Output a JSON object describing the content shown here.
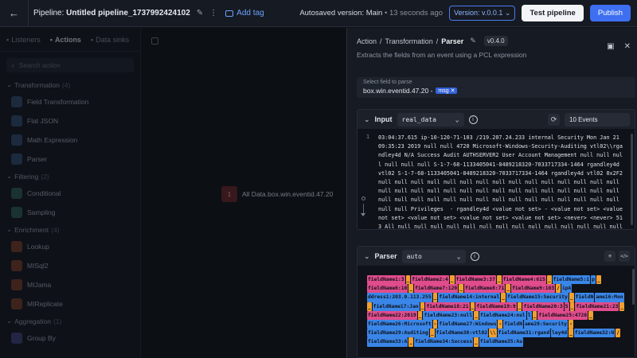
{
  "topbar": {
    "back_icon": "arrow-left-icon",
    "title_prefix": "Pipeline:",
    "title_name": "Untitled pipeline_1737992424102",
    "add_tag_label": "Add tag",
    "autosave_label": "Autosaved version: Main",
    "autosave_time": "• 13 seconds ago",
    "version_label": "Version: v.0.0.1 ⌄",
    "test_label": "Test pipeline",
    "publish_label": "Publish"
  },
  "left": {
    "tabs": [
      {
        "label": "Listeners",
        "icon": "headset-icon"
      },
      {
        "label": "Actions",
        "icon": "actions-icon"
      },
      {
        "label": "Data sinks",
        "icon": "database-icon"
      }
    ],
    "search_placeholder": "Search action",
    "sections": [
      {
        "title": "Transformation",
        "count": "(4)",
        "items": [
          {
            "label": "Field Transformation",
            "color": "#2f4a6e"
          },
          {
            "label": "Flat JSON",
            "color": "#2f4a6e"
          },
          {
            "label": "Math Expression",
            "color": "#2f4a6e"
          },
          {
            "label": "Parser",
            "color": "#2f4a6e"
          }
        ]
      },
      {
        "title": "Filtering",
        "count": "(2)",
        "items": [
          {
            "label": "Conditional",
            "color": "#2a5a52"
          },
          {
            "label": "Sampling",
            "color": "#2a5a52"
          }
        ]
      },
      {
        "title": "Enrichment",
        "count": "(4)",
        "items": [
          {
            "label": "Lookup",
            "color": "#7a3a24"
          },
          {
            "label": "MISql2",
            "color": "#7a3a24"
          },
          {
            "label": "MIJama",
            "color": "#7a3a24"
          },
          {
            "label": "MIReplicate",
            "color": "#7a3a24"
          }
        ]
      },
      {
        "title": "Aggregation",
        "count": "(1)",
        "items": [
          {
            "label": "Group By",
            "color": "#3b3f7a"
          }
        ]
      }
    ]
  },
  "canvas": {
    "node_badge": "1",
    "node_label": "All Data.box.win.eventid.47.20"
  },
  "right": {
    "breadcrumb": [
      "Action",
      "Transformation",
      "Parser"
    ],
    "version_badge": "v0.4.0",
    "subtitle": "Extracts the fields from an event using a PCL expression",
    "field_label": "Select field to parse",
    "field_value": "box.win.eventid.47.20 -",
    "field_tag": "msg ✕",
    "input": {
      "label": "Input",
      "source": "real_data",
      "events": "10 Events",
      "line_number": "1",
      "code": "03:04:37.615 ip-10-120-71-103 /219.207.24.233 internal Security Mon Jan 21 09:35:23 2019 null null 4720 Microsoft-Windows-Security-Auditing vtl02\\\\rgandley4d N/A Success Audit AUTHSERVER2 User Account Management null null null null null null S-1-7-68-1133405041-8489218320-7033717334-1464 rgandley4d vtl02 S-1-7-68-1133405041-8489218320-7033717334-1464 rgandley4d vtl02 0x2F2 null null null null null null null null null null null null null null null null null null null null null null null null null null null null null null null null null null null null null null null null null null null null null null null Privileges  - rgandley4d <value not set> - <value not set> <value not set> <value not set> <value not set> <value not set> <never> <never> 513 All null null null null null null null null null null null null null null null null null null null null null null null null null null null null null null null"
    },
    "parser": {
      "label": "Parser",
      "mode": "auto",
      "tools": [
        "≡",
        "</>"
      ],
      "tokens": [
        {
          "t": "fieldName1:3",
          "c": "pk"
        },
        {
          "t": "_",
          "c": "or"
        },
        {
          "t": "fieldName2:4",
          "c": "pk"
        },
        {
          "t": "_",
          "c": "or"
        },
        {
          "t": "fieldName3:37",
          "c": "pk"
        },
        {
          "t": "_",
          "c": "or"
        },
        {
          "t": "fieldName4:615",
          "c": "pk"
        },
        {
          "t": "_",
          "c": "or"
        },
        {
          "t": "fieldName5:i",
          "c": "bl"
        },
        {
          "t": "p",
          "c": "bl"
        },
        {
          "t": "_",
          "c": "or"
        },
        {
          "t": "fieldName6:10",
          "c": "pk"
        },
        {
          "t": "_",
          "c": "or"
        },
        {
          "t": "fieldName7:120",
          "c": "pk"
        },
        {
          "t": "_",
          "c": "or"
        },
        {
          "t": "fieldName8:71",
          "c": "pk"
        },
        {
          "t": "_",
          "c": "or"
        },
        {
          "t": "fieldName9:103",
          "c": "pk"
        },
        {
          "t": "/",
          "c": "or"
        },
        {
          "t": "ipA",
          "c": "bl"
        },
        {
          "t": "ddress1:203.0.113.255",
          "c": "bl"
        },
        {
          "t": "_",
          "c": "or"
        },
        {
          "t": "fieldName14:internal",
          "c": "bl"
        },
        {
          "t": "_",
          "c": "or"
        },
        {
          "t": "fieldName15:Security",
          "c": "bl"
        },
        {
          "t": "_",
          "c": "or"
        },
        {
          "t": "fieldN",
          "c": "bl"
        },
        {
          "t": "ame16:Mon",
          "c": "bl"
        },
        {
          "t": "_",
          "c": "or"
        },
        {
          "t": "fieldName17:Jan",
          "c": "bl"
        },
        {
          "t": "_",
          "c": "or"
        },
        {
          "t": "fieldName18:21",
          "c": "pk"
        },
        {
          "t": "_",
          "c": "or"
        },
        {
          "t": "fieldName19:9",
          "c": "pk"
        },
        {
          "t": "_",
          "c": "or"
        },
        {
          "t": "fieldName20:3",
          "c": "pk"
        },
        {
          "t": "5",
          "c": "pk"
        },
        {
          "t": "_",
          "c": "or"
        },
        {
          "t": "fieldName21:23",
          "c": "pk"
        },
        {
          "t": "_",
          "c": "or"
        },
        {
          "t": "fieldName22:2019",
          "c": "pk"
        },
        {
          "t": "_",
          "c": "or"
        },
        {
          "t": "fieldName23:null",
          "c": "bl"
        },
        {
          "t": "_",
          "c": "or"
        },
        {
          "t": "fieldName24:nul",
          "c": "bl"
        },
        {
          "t": "l",
          "c": "bl"
        },
        {
          "t": "_",
          "c": "or"
        },
        {
          "t": "fieldName25:4720",
          "c": "pk"
        },
        {
          "t": "_",
          "c": "or"
        },
        {
          "t": "fieldName26:Microsoft",
          "c": "bl"
        },
        {
          "t": "-",
          "c": "or"
        },
        {
          "t": "fieldName27:Windows",
          "c": "bl"
        },
        {
          "t": "-",
          "c": "or"
        },
        {
          "t": "fieldN",
          "c": "bl"
        },
        {
          "t": "ame28:Security",
          "c": "bl"
        },
        {
          "t": "-",
          "c": "or"
        },
        {
          "t": "fieldName29:Auditing",
          "c": "bl"
        },
        {
          "t": "_",
          "c": "or"
        },
        {
          "t": "fieldName30:vtl02",
          "c": "bl"
        },
        {
          "t": "\\\\",
          "c": "or"
        },
        {
          "t": "fieldName31:rgand",
          "c": "bl"
        },
        {
          "t": "ley4d",
          "c": "bl"
        },
        {
          "t": "_",
          "c": "or"
        },
        {
          "t": "fieldName32:N",
          "c": "bl"
        },
        {
          "t": "/",
          "c": "or"
        },
        {
          "t": "fieldName33:A",
          "c": "bl"
        },
        {
          "t": "_",
          "c": "or"
        },
        {
          "t": "fieldName34:Success",
          "c": "bl"
        },
        {
          "t": "_",
          "c": "or"
        },
        {
          "t": "fieldName35:Au",
          "c": "bl"
        }
      ]
    }
  }
}
